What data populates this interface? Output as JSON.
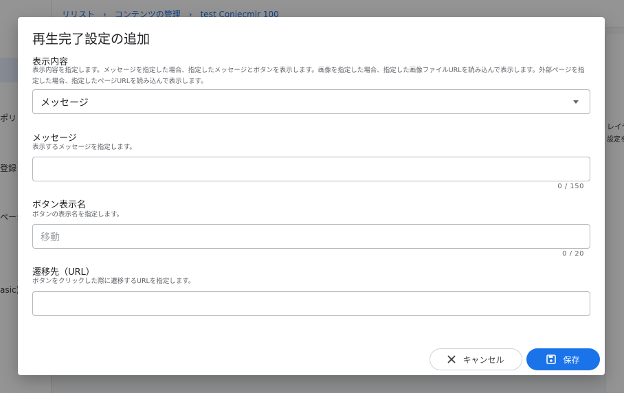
{
  "background": {
    "breadcrumb": "リリスト　›　コンテンツの管理　›　test Coniecmlr 100",
    "side_texts": [
      "ポリ",
      "登録",
      "ページ",
      "asic)"
    ],
    "right_texts": [
      "レイヤ",
      "設定を"
    ]
  },
  "dialog": {
    "title": "再生完了設定の追加",
    "display": {
      "label": "表示内容",
      "description": "表示内容を指定します。メッセージを指定した場合、指定したメッセージとボタンを表示します。画像を指定した場合、指定した画像ファイルURLを読み込んで表示します。外部ページを指定した場合、指定したページURLを読み込んで表示します。",
      "selected": "メッセージ"
    },
    "message": {
      "label": "メッセージ",
      "description": "表示するメッセージを指定します。",
      "value": "",
      "counter": "0 / 150"
    },
    "button_name": {
      "label": "ボタン表示名",
      "description": "ボタンの表示名を指定します。",
      "placeholder": "移動",
      "counter": "0 / 20"
    },
    "url": {
      "label": "遷移先（URL）",
      "description": "ボタンをクリックした際に遷移するURLを指定します。",
      "value": ""
    },
    "actions": {
      "cancel_label": "キャンセル",
      "save_label": "保存"
    }
  },
  "colors": {
    "primary": "#1a73e8",
    "scrim": "#000000"
  },
  "icons": [
    "close-icon",
    "save-icon",
    "chevron-down-icon"
  ]
}
